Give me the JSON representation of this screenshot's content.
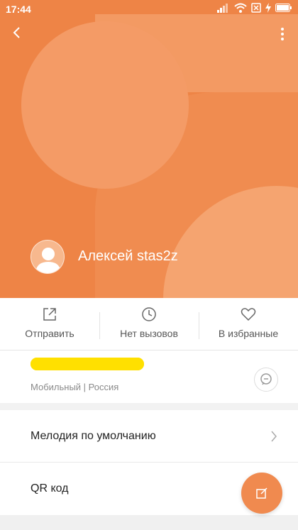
{
  "status_bar": {
    "time": "17:44"
  },
  "contact": {
    "name": "Алексей stas2z"
  },
  "actions": [
    {
      "label": "Отправить",
      "icon": "share-icon"
    },
    {
      "label": "Нет вызовов",
      "icon": "clock-icon"
    },
    {
      "label": "В избранные",
      "icon": "heart-icon"
    }
  ],
  "phone": {
    "number": "",
    "description": "Мобильный | Россия"
  },
  "rows": {
    "ringtone": "Мелодия по умолчанию",
    "qr": "QR код"
  },
  "colors": {
    "accent": "#ee8446",
    "highlight": "#ffe000"
  }
}
